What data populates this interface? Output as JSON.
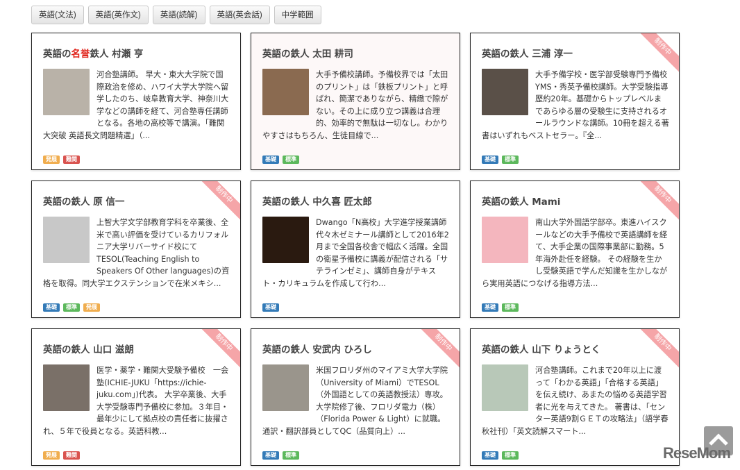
{
  "filters": [
    "英語(文法)",
    "英語(英作文)",
    "英語(読解)",
    "英語(英会話)",
    "中学範囲"
  ],
  "tag_colors": {
    "基礎": "#337ab7",
    "標準": "#5cb85c",
    "発展": "#f0ad4e",
    "難関": "#d9534f"
  },
  "ribbon_label": "制作中",
  "cards": [
    {
      "title_pre": "英語の",
      "title_hl": "名誉",
      "title_post": "鉄人 村瀬 亨",
      "photo": "#b9b2a8",
      "ribbon": false,
      "tinted": false,
      "text": "河合塾講師。 早大・東大大学院で国際政治を修め、ハワイ大学大学院へ留学したのち、岐阜教育大学、神奈川大学などの講師を経て、河合塾専任講師となる。各地の高校等で講演。「難関大突破 英語長文問題精選」（...",
      "tags": [
        "発展",
        "難関"
      ]
    },
    {
      "title_pre": "英語の鉄人 太田 耕司",
      "title_hl": "",
      "title_post": "",
      "photo": "#8a6a50",
      "ribbon": false,
      "tinted": true,
      "text": "大手予備校講師。予備校界では「太田のプリント」は「鉄板プリント」と呼ばれ、簡潔でありながら、精緻で隙がない。その上に成り立つ講義は合理的、効率的で無駄は一切なし。わかりやすさはもちろん、生徒目線で...",
      "tags": [
        "基礎",
        "標準"
      ]
    },
    {
      "title_pre": "英語の鉄人 三浦 淳一",
      "title_hl": "",
      "title_post": "",
      "photo": "#5a5048",
      "ribbon": true,
      "tinted": false,
      "text": "大手予備学校・医学部受験専門予備校YMS・秀英予備校講師。大学受験指導歴約20年。基礎からトップレベルまであらゆる層の受験生に支持されるオールラウンドな講師。10冊を超える著書はいずれもベストセラー。『全...",
      "tags": [
        "基礎",
        "標準"
      ]
    },
    {
      "title_pre": "英語の鉄人 原 信一",
      "title_hl": "",
      "title_post": "",
      "photo": "#c8c8c8",
      "ribbon": true,
      "tinted": false,
      "text": "上智大学文学部教育学科を卒業後、全米で高い評価を受けているカリフォルニア大学リバーサイド校にてTESOL(Teaching English to Speakers Of Other languages)の資格を取得。同大学エクステンションで在米メキシ...",
      "tags": [
        "基礎",
        "標準",
        "発展"
      ]
    },
    {
      "title_pre": "英語の鉄人 中久喜 匠太郎",
      "title_hl": "",
      "title_post": "",
      "photo": "#2a1a10",
      "ribbon": false,
      "tinted": false,
      "text": "Dwango「N高校」大学進学授業講師 代々木ゼミナール講師として2016年2月まで全国各校舎で幅広く活躍。全国の衛星予備校に講義が配信される「サテラインゼミ」、講師自身がテキスト・カリキュラムを作成して行わ...",
      "tags": [
        "基礎"
      ]
    },
    {
      "title_pre": "英語の鉄人 Mami",
      "title_hl": "",
      "title_post": "",
      "photo": "#f4b6be",
      "ribbon": true,
      "tinted": false,
      "text": "南山大学外国語学部卒。東進ハイスクールなどの大手予備校で英語講師を経て、大手企業の国際事業部に勤務。5年海外赴任を経験。 その経験を生かし受験英語で学んだ知識を生かしながら実用英語につなげる指導方法...",
      "tags": [
        "基礎",
        "標準"
      ]
    },
    {
      "title_pre": "英語の鉄人 山口 滋朗",
      "title_hl": "",
      "title_post": "",
      "photo": "#7a7068",
      "ribbon": true,
      "tinted": false,
      "text": "医学・薬学・難関大受験予備校　一会塾(ICHIE-JUKU「https://ichie-juku.com」)代表。 大学卒業後、大手大学受験専門予備校に参加。３年目・最年少にして拠点校の責任者に抜擢され、５年で役員となる。英語科教...",
      "tags": [
        "発展",
        "難関"
      ]
    },
    {
      "title_pre": "英語の鉄人 安武内 ひろし",
      "title_hl": "",
      "title_post": "",
      "photo": "#9a958c",
      "ribbon": true,
      "tinted": false,
      "text": "米国フロリダ州のマイアミ大学大学院（University of Miami）でTESOL（外国語としての英語教授法）専攻。大学院修了後、フロリダ電力（株）（Florida Power & Light）に就職。通訳・翻訳部員としてQC（品質向上）...",
      "tags": [
        "基礎",
        "標準"
      ]
    },
    {
      "title_pre": "英語の鉄人 山下 りょうとく",
      "title_hl": "",
      "title_post": "",
      "photo": "#b8c8b8",
      "ribbon": true,
      "tinted": false,
      "text": "河合塾講師。これまで20年以上に渡って「わかる英語」「合格する英語」を伝え続け、あまたの悩める英語学習者に光を与えてきた。 著書は、「センター英語9割ＧＥＴの攻略法」（語学春秋社刊）「英文読解スマート...",
      "tags": [
        "基礎",
        "標準"
      ]
    }
  ],
  "logo": "ReseMom"
}
